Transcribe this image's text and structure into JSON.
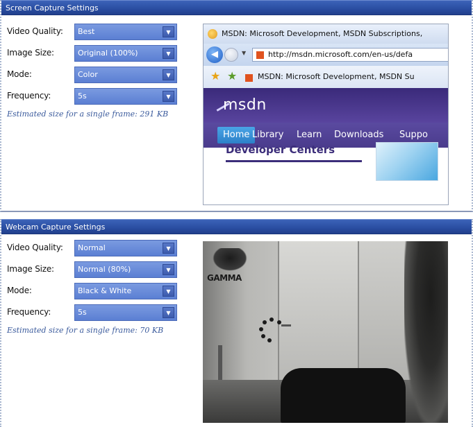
{
  "screen_panel": {
    "header": "Screen Capture Settings",
    "rows": [
      {
        "label": "Video Quality:",
        "value": "Best"
      },
      {
        "label": "Image Size:",
        "value": "Original (100%)"
      },
      {
        "label": "Mode:",
        "value": "Color"
      },
      {
        "label": "Frequency:",
        "value": "5s"
      }
    ],
    "estimate": "Estimated size for a single frame: 291 KB",
    "preview": {
      "window_title": "MSDN: Microsoft Development, MSDN Subscriptions,",
      "url": "http://msdn.microsoft.com/en-us/defa",
      "tab_title": "MSDN: Microsoft Development, MSDN Su",
      "logo": "msdn",
      "nav": [
        "Home",
        "Library",
        "Learn",
        "Downloads",
        "Suppo"
      ],
      "section_heading": "Developer Centers"
    }
  },
  "webcam_panel": {
    "header": "Webcam Capture Settings",
    "rows": [
      {
        "label": "Video Quality:",
        "value": "Normal"
      },
      {
        "label": "Image Size:",
        "value": "Normal (80%)"
      },
      {
        "label": "Mode:",
        "value": "Black & White"
      },
      {
        "label": "Frequency:",
        "value": "5s"
      }
    ],
    "estimate": "Estimated size for a single frame: 70 KB",
    "preview": {
      "brand_text": "GAMMA"
    }
  },
  "colors": {
    "header_bg": "#2b4fa3",
    "select_bg": "#6a8cdb",
    "estimate_text": "#3a5a9c"
  },
  "icons": [
    "chevron-down-icon",
    "browser-icon",
    "back-icon",
    "forward-icon",
    "favorites-star-icon",
    "add-favorite-icon",
    "page-favicon"
  ]
}
